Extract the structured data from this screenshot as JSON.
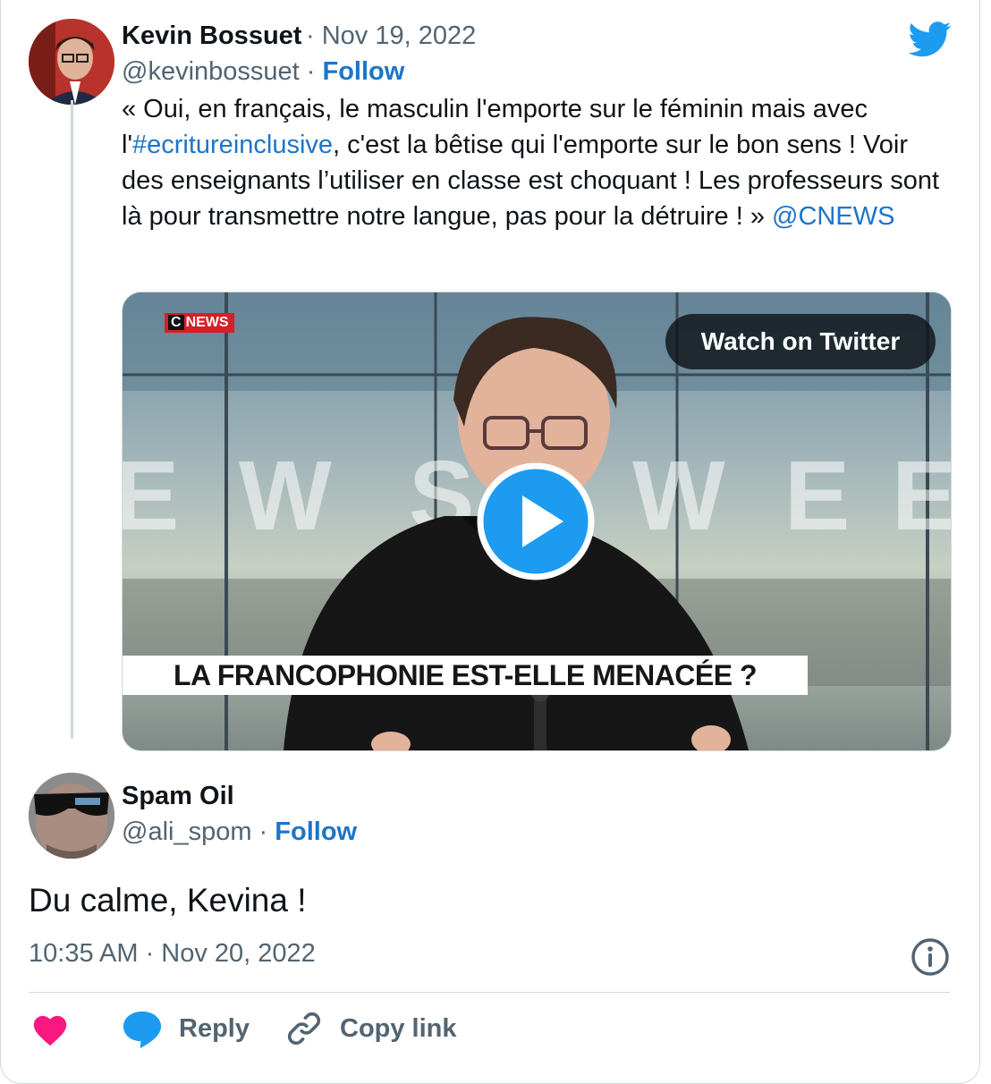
{
  "tweet": {
    "author_name": "Kevin Bossuet",
    "separator": " · ",
    "date": "Nov 19, 2022",
    "handle": "@kevinbossuet",
    "follow_label": "Follow",
    "text_1": "« Oui, en français, le masculin l'emporte sur le féminin mais avec l'",
    "hashtag": "#ecritureinclusive",
    "text_2": ", c'est la bêtise qui l'emporte sur le bon sens ! Voir des enseignants l’utiliser en classe est choquant ! Les professeurs sont là pour transmettre notre langue, pas pour la détruire ! » ",
    "mention": "@CNEWS",
    "media": {
      "watch_label": "Watch on Twitter",
      "channel_badge_c": "C",
      "channel_badge_rest": "NEWS",
      "caption": "LA FRANCOPHONIE EST-ELLE MENACÉE ?"
    }
  },
  "reply": {
    "author_name": "Spam Oil",
    "handle": "@ali_spom",
    "follow_label": "Follow",
    "text": "Du calme, Kevina !",
    "timestamp": "10:35 AM · Nov 20, 2022"
  },
  "actions": {
    "reply_label": "Reply",
    "copy_label": "Copy link"
  },
  "colors": {
    "link": "#1d75c8",
    "muted": "#536471",
    "heart": "#f91880",
    "twitter_blue": "#1d9bf0"
  },
  "icons": [
    "twitter-logo-icon",
    "play-icon",
    "info-icon",
    "heart-icon",
    "reply-bubble-icon",
    "link-icon"
  ]
}
